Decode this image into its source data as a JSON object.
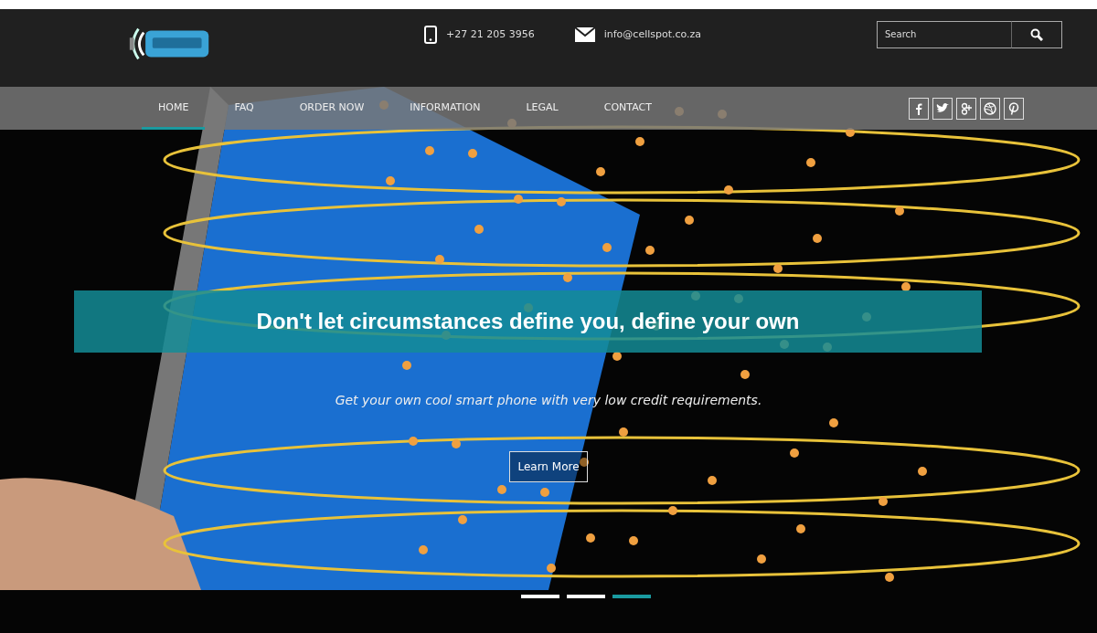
{
  "header": {
    "phone": "+27 21 205 3956",
    "email": "info@cellspot.co.za",
    "search": {
      "placeholder": "Search"
    }
  },
  "nav": [
    {
      "label": "HOME",
      "selected": true
    },
    {
      "label": "FAQ",
      "selected": false
    },
    {
      "label": "ORDER NOW",
      "selected": false
    },
    {
      "label": "INFORMATION",
      "selected": false
    },
    {
      "label": "LEGAL",
      "selected": false
    },
    {
      "label": "CONTACT",
      "selected": false
    }
  ],
  "social": [
    {
      "kind": "facebook"
    },
    {
      "kind": "twitter"
    },
    {
      "kind": "googleplus"
    },
    {
      "kind": "dribbble"
    },
    {
      "kind": "pinterest"
    }
  ],
  "hero": {
    "headline": "Don't let circumstances define you, define your own",
    "subtitle": "Get your own cool smart phone with very low credit requirements.",
    "button": "Learn More"
  },
  "slides": [
    {
      "selected": false
    },
    {
      "selected": false
    },
    {
      "selected": true
    }
  ]
}
